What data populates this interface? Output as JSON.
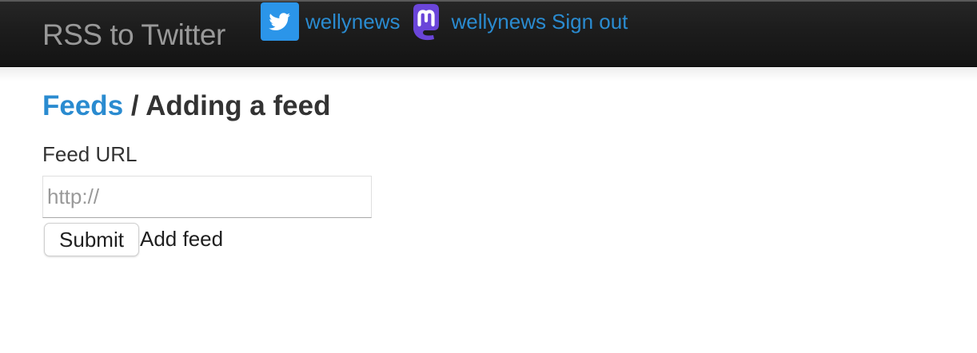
{
  "navbar": {
    "brand": "RSS to Twitter",
    "twitter": {
      "icon": "twitter-bird-icon",
      "username": "wellynews",
      "color": "#2b95e9"
    },
    "mastodon": {
      "icon": "mastodon-logo-icon",
      "username": "wellynews",
      "color": "#6a45d9"
    },
    "sign_out": "Sign out"
  },
  "breadcrumb": {
    "parent": "Feeds",
    "separator": "/",
    "current": "Adding a feed"
  },
  "form": {
    "url_label": "Feed URL",
    "url_value": "",
    "url_placeholder": "http://",
    "submit_label": "Submit",
    "trailing_text": "Add feed"
  },
  "colors": {
    "link": "#2a8bd0",
    "navbar_background": "#1c1c1c",
    "brand_text": "#999999"
  }
}
